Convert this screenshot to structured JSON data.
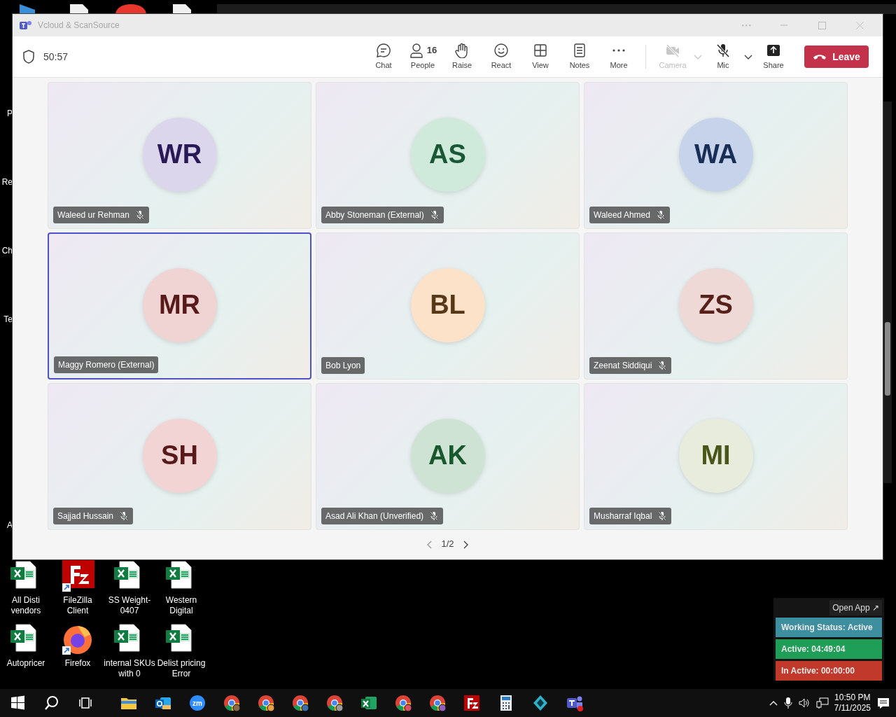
{
  "desktop_edge_labels": [
    "P",
    "Re",
    "Ch",
    "Te",
    "A"
  ],
  "desktop_icons": [
    {
      "kind": "excel",
      "label": "All Disti vendors",
      "shortcut": false
    },
    {
      "kind": "filezilla",
      "label": "FileZilla Client",
      "shortcut": true
    },
    {
      "kind": "excel",
      "label": "SS Weight-0407",
      "shortcut": false
    },
    {
      "kind": "excel",
      "label": "Western Digital",
      "shortcut": false
    },
    {
      "kind": "excel",
      "label": "Autopricer",
      "shortcut": false
    },
    {
      "kind": "firefox",
      "label": "Firefox",
      "shortcut": true
    },
    {
      "kind": "excel",
      "label": "internal SKUs with 0",
      "shortcut": false
    },
    {
      "kind": "excel",
      "label": "Delist pricing Error",
      "shortcut": false
    }
  ],
  "window": {
    "title": "Vcloud & ScanSource",
    "timer": "50:57",
    "toolbar": [
      {
        "label": "Chat",
        "disabled": false,
        "dropdown": false
      },
      {
        "label": "People",
        "count": "16",
        "disabled": false,
        "dropdown": false
      },
      {
        "label": "Raise",
        "disabled": false,
        "dropdown": false
      },
      {
        "label": "React",
        "disabled": false,
        "dropdown": false
      },
      {
        "label": "View",
        "disabled": false,
        "dropdown": false
      },
      {
        "label": "Notes",
        "disabled": false,
        "dropdown": false
      },
      {
        "label": "More",
        "disabled": false,
        "dropdown": false
      },
      {
        "label": "Camera",
        "disabled": true,
        "dropdown": true
      },
      {
        "label": "Mic",
        "disabled": false,
        "dropdown": true
      },
      {
        "label": "Share",
        "disabled": false,
        "dropdown": false
      }
    ],
    "leave_button": "Leave",
    "participants": [
      {
        "initials": "WR",
        "name": "Waleed ur Rehman",
        "muted": true,
        "selected": false,
        "color": "#dcd6ec"
      },
      {
        "initials": "AS",
        "name": "Abby Stoneman (External)",
        "muted": true,
        "selected": false,
        "color": "#cfeadb"
      },
      {
        "initials": "WA",
        "name": "Waleed Ahmed",
        "muted": true,
        "selected": false,
        "color": "#c7d3ea"
      },
      {
        "initials": "MR",
        "name": "Maggy Romero (External)",
        "muted": false,
        "selected": true,
        "color": "#f0d3d3"
      },
      {
        "initials": "BL",
        "name": "Bob Lyon",
        "muted": false,
        "selected": false,
        "color": "#fbe2c8"
      },
      {
        "initials": "ZS",
        "name": "Zeenat Siddiqui",
        "muted": true,
        "selected": false,
        "color": "#eed9d6"
      },
      {
        "initials": "SH",
        "name": "Sajjad Hussain",
        "muted": true,
        "selected": false,
        "color": "#f2d4d4"
      },
      {
        "initials": "AK",
        "name": "Asad Ali Khan (Unverified)",
        "muted": true,
        "selected": false,
        "color": "#cfe3d5"
      },
      {
        "initials": "MI",
        "name": "Musharraf Iqbal",
        "muted": true,
        "selected": false,
        "color": "#e8ecdc"
      }
    ],
    "page": "1/2"
  },
  "status_widget": {
    "open_app": "Open App ↗",
    "rows": [
      {
        "text": "Working Status: Active",
        "color": "#3d8fa0"
      },
      {
        "text": "Active: 04:49:04",
        "color": "#1f9e57"
      },
      {
        "text": "In Active: 00:00:00",
        "color": "#c0392b"
      }
    ]
  },
  "taskbar": {
    "apps": [
      {
        "kind": "folder"
      },
      {
        "kind": "outlook"
      },
      {
        "kind": "zoom",
        "label": "zm"
      },
      {
        "kind": "chrome",
        "color": "#8a6a4a"
      },
      {
        "kind": "chrome",
        "color": "#e8a040"
      },
      {
        "kind": "chrome",
        "color": "#3b6fb0"
      },
      {
        "kind": "chrome",
        "color": "#9a9a9a"
      },
      {
        "kind": "excel"
      },
      {
        "kind": "chrome",
        "color": "#d8506a"
      },
      {
        "kind": "chrome",
        "color": "#9060c0"
      },
      {
        "kind": "filezilla"
      },
      {
        "kind": "calculator"
      },
      {
        "kind": "diamond"
      },
      {
        "kind": "teams"
      }
    ],
    "time": "10:50 PM",
    "date": "7/11/2025"
  }
}
